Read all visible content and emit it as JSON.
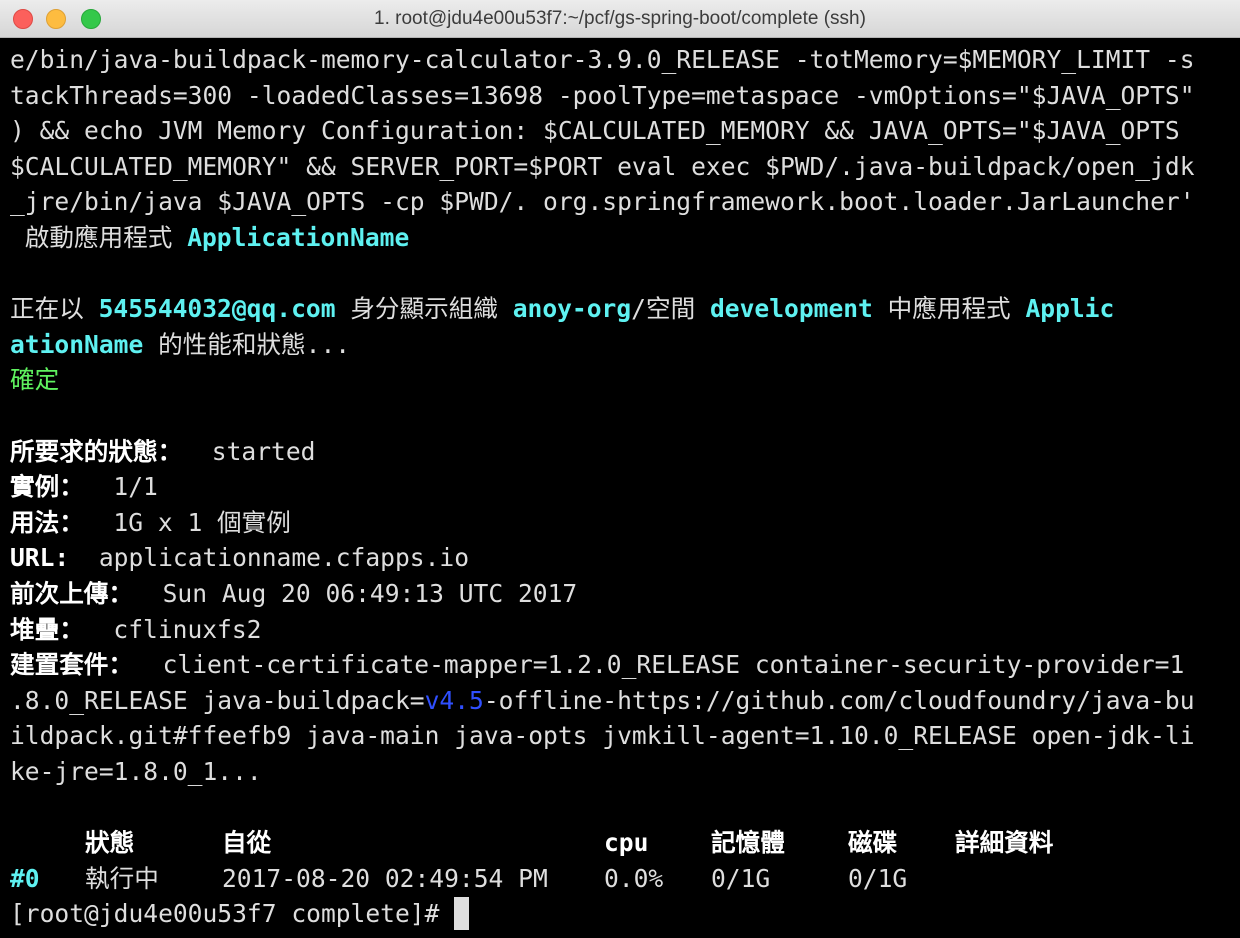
{
  "window": {
    "title": "1. root@jdu4e00u53f7:~/pcf/gs-spring-boot/complete (ssh)"
  },
  "terminal": {
    "cmd": {
      "l1": "e/bin/java-buildpack-memory-calculator-3.9.0_RELEASE -totMemory=$MEMORY_LIMIT -s",
      "l2": "tackThreads=300 -loadedClasses=13698 -poolType=metaspace -vmOptions=\"$JAVA_OPTS\"",
      "l3": ") && echo JVM Memory Configuration: $CALCULATED_MEMORY && JAVA_OPTS=\"$JAVA_OPTS",
      "l4": "$CALCULATED_MEMORY\" && SERVER_PORT=$PORT eval exec $PWD/.java-buildpack/open_jdk",
      "l5": "_jre/bin/java $JAVA_OPTS -cp $PWD/. org.springframework.boot.loader.JarLauncher'"
    },
    "start": {
      "prefix": " 啟動應用程式 ",
      "app": "ApplicationName"
    },
    "show": {
      "p1": "正在以 ",
      "user": "545544032@qq.com",
      "p2": " 身分顯示組織 ",
      "org": "anoy-org",
      "p3": "/空間 ",
      "space": "development",
      "p4": " 中應用程式 ",
      "app_a": "Applic",
      "app_b": "ationName",
      "p5": " 的性能和狀態..."
    },
    "ok": "確定",
    "info": {
      "requested_label": "所要求的狀態：",
      "requested_value": "  started",
      "instances_label": "實例：",
      "instances_value": "  1/1",
      "usage_label": "用法：",
      "usage_value": "  1G x 1 個實例",
      "url_label": "URL:",
      "url_value": "  applicationname.cfapps.io",
      "uploaded_label": "前次上傳：",
      "uploaded_value": "  Sun Aug 20 06:49:13 UTC 2017",
      "stack_label": "堆疊：",
      "stack_value": "  cflinuxfs2",
      "bp_label": "建置套件：",
      "bp_value": "  client-certificate-mapper=1.2.0_RELEASE container-security-provider=1",
      "bp_l2a": ".8.0_RELEASE java-buildpack=",
      "bp_l2b": "v4.5",
      "bp_l2c": "-offline-https://github.com/cloudfoundry/java-bu",
      "bp_l3": "ildpack.git#ffeefb9 java-main java-opts jvmkill-agent=1.10.0_RELEASE open-jdk-li",
      "bp_l4": "ke-jre=1.8.0_1..."
    },
    "table": {
      "headers": {
        "state": "狀態",
        "since": "自從",
        "cpu": "cpu",
        "memory": "記憶體",
        "disk": "磁碟",
        "details": "詳細資料"
      },
      "rows": [
        {
          "index": "#0",
          "state": "執行中",
          "since": "2017-08-20 02:49:54 PM",
          "cpu": "0.0%",
          "memory": "0/1G",
          "disk": "0/1G"
        }
      ]
    },
    "prompt": "[root@jdu4e00u53f7 complete]# "
  },
  "colors": {
    "background": "#000000",
    "text": "#dedede",
    "cyan_highlight": "#5ef1f1",
    "green_ok": "#5ff25f",
    "blue_version": "#2f4fff"
  }
}
